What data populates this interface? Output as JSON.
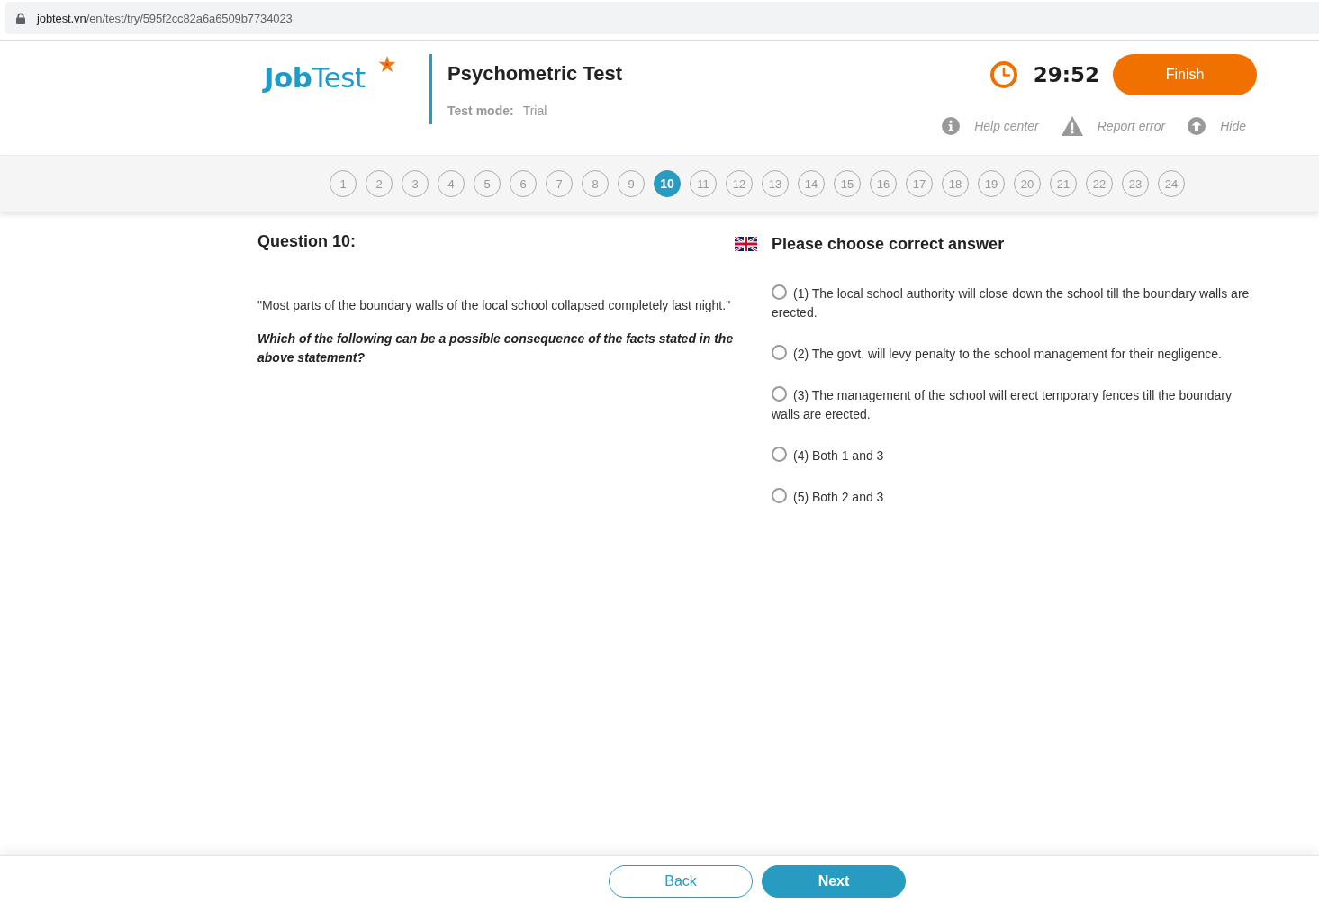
{
  "browser": {
    "url": {
      "host": "jobtest.vn",
      "path": "/en/test/try/595f2cc82a6a6509b7734023"
    }
  },
  "header": {
    "logo": "**Job**Test",
    "title": "Psychometric Test",
    "mode_label": "Test mode:",
    "mode_value": "Trial",
    "timer": "29:52",
    "finish_button": "Finish",
    "links": [
      {
        "kind": "info",
        "label": "Help center"
      },
      {
        "kind": "warning",
        "label": "Report error"
      },
      {
        "kind": "hide",
        "label": "Hide"
      }
    ]
  },
  "question_nav": [
    {
      "label": "1",
      "selected": false
    },
    {
      "label": "2",
      "selected": false
    },
    {
      "label": "3",
      "selected": false
    },
    {
      "label": "4",
      "selected": false
    },
    {
      "label": "5",
      "selected": false
    },
    {
      "label": "6",
      "selected": false
    },
    {
      "label": "7",
      "selected": false
    },
    {
      "label": "8",
      "selected": false
    },
    {
      "label": "9",
      "selected": false
    },
    {
      "label": "10",
      "selected": true
    },
    {
      "label": "11",
      "selected": false
    },
    {
      "label": "12",
      "selected": false
    },
    {
      "label": "13",
      "selected": false
    },
    {
      "label": "14",
      "selected": false
    },
    {
      "label": "15",
      "selected": false
    },
    {
      "label": "16",
      "selected": false
    },
    {
      "label": "17",
      "selected": false
    },
    {
      "label": "18",
      "selected": false
    },
    {
      "label": "19",
      "selected": false
    },
    {
      "label": "20",
      "selected": false
    },
    {
      "label": "21",
      "selected": false
    },
    {
      "label": "22",
      "selected": false
    },
    {
      "label": "23",
      "selected": false
    },
    {
      "label": "24",
      "selected": false
    }
  ],
  "question": {
    "title": "Question 10:",
    "statement": "\"Most parts of the boundary walls of the local school collapsed completely last night.\"",
    "prompt": "Which of the following can be a possible consequence of the facts stated in the above statement?"
  },
  "answers": {
    "heading": "Please choose correct answer",
    "options": [
      {
        "label": "(1) The local school authority will close down the school till the boundary walls are erected.",
        "selected": false
      },
      {
        "label": "(2) The govt. will levy penalty to the school management for their negligence.",
        "selected": false
      },
      {
        "label": "(3) The management of the school will erect temporary fences till the boundary walls are erected.",
        "selected": false
      },
      {
        "label": "(4) Both 1 and 3",
        "selected": false
      },
      {
        "label": "(5) Both 2 and 3",
        "selected": false
      }
    ]
  },
  "footer": {
    "back_button": "Back",
    "next_button": "Next"
  }
}
